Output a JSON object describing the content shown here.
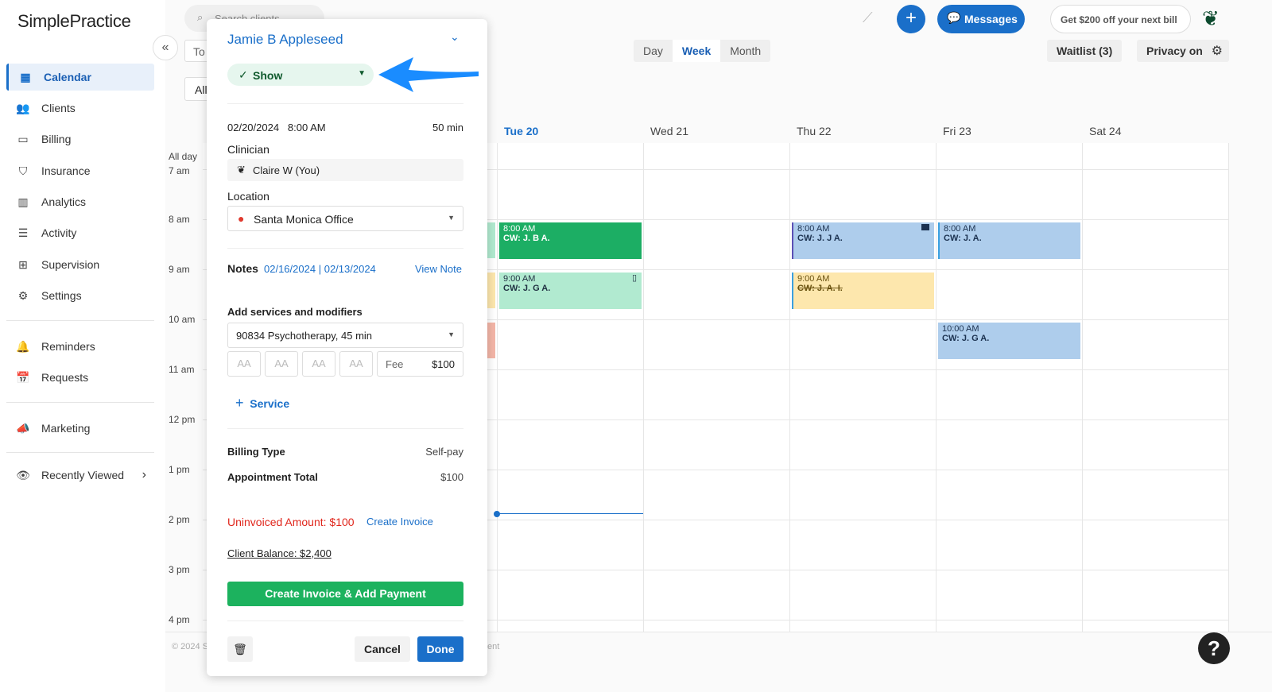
{
  "app": {
    "logo": "SimplePractice"
  },
  "sidebar": {
    "items": [
      {
        "label": "Calendar",
        "icon": "calendar-icon",
        "glyph": "▦"
      },
      {
        "label": "Clients",
        "icon": "users-icon",
        "glyph": "👥"
      },
      {
        "label": "Billing",
        "icon": "credit-card-icon",
        "glyph": "▭"
      },
      {
        "label": "Insurance",
        "icon": "shield-icon",
        "glyph": "⛉"
      },
      {
        "label": "Analytics",
        "icon": "bar-chart-icon",
        "glyph": "▥"
      },
      {
        "label": "Activity",
        "icon": "list-icon",
        "glyph": "☰"
      },
      {
        "label": "Supervision",
        "icon": "supervision-icon",
        "glyph": "⊞"
      },
      {
        "label": "Settings",
        "icon": "gear-icon",
        "glyph": "⚙"
      },
      {
        "label": "Reminders",
        "icon": "bell-icon",
        "glyph": "🔔"
      },
      {
        "label": "Requests",
        "icon": "calendar-plus-icon",
        "glyph": "📅"
      },
      {
        "label": "Marketing",
        "icon": "megaphone-icon",
        "glyph": "📣"
      },
      {
        "label": "Recently Viewed",
        "icon": "eye-icon",
        "glyph": "👁"
      }
    ]
  },
  "header": {
    "search_placeholder": "Search clients",
    "messages": "Messages",
    "promo": "Get $200 off your next bill",
    "today": "To",
    "filter": "All"
  },
  "calendar": {
    "views": [
      "Day",
      "Week",
      "Month"
    ],
    "active_view": "Week",
    "waitlist": "Waitlist (3)",
    "privacy": "Privacy on",
    "days": [
      "Tue 20",
      "Wed 21",
      "Thu 22",
      "Fri 23",
      "Sat 24"
    ],
    "all_day": "All day",
    "hours": [
      "7 am",
      "8 am",
      "9 am",
      "10 am",
      "11 am",
      "12 pm",
      "1 pm",
      "2 pm",
      "3 pm",
      "4 pm"
    ],
    "events": [
      {
        "time": "8:00 AM",
        "title": "CW: J. B A.",
        "color": "#1cae64"
      },
      {
        "time": "9:00 AM",
        "title": "CW: J. G A.",
        "color": "#b1ead0"
      },
      {
        "time": "8:00 AM",
        "title": "CW: J. J A.",
        "color": "#aecdec"
      },
      {
        "time": "9:00 AM",
        "title": "CW: J. A. I.",
        "color": "#fde7ad"
      },
      {
        "time": "8:00 AM",
        "title": "CW: J. A.",
        "color": "#aecdec"
      },
      {
        "time": "10:00 AM",
        "title": "CW: J. G A.",
        "color": "#aecdec"
      }
    ],
    "footer": "© 2024 S",
    "footer_right": "ent"
  },
  "popup": {
    "client": "Jamie B Appleseed",
    "status": "Show",
    "date": "02/20/2024",
    "time": "8:00 AM",
    "duration": "50 min",
    "clinician_label": "Clinician",
    "clinician": "Claire W (You)",
    "location_label": "Location",
    "location": "Santa Monica Office",
    "notes_label": "Notes",
    "note1": "02/16/2024",
    "note_sep": "|",
    "note2": "02/13/2024",
    "view_note": "View Note",
    "services_label": "Add services and modifiers",
    "service": "90834 Psychotherapy, 45 min",
    "modifier": "AA",
    "fee_label": "Fee",
    "fee": "$100",
    "add_service": "Service",
    "billing_type_label": "Billing Type",
    "billing_type": "Self-pay",
    "total_label": "Appointment Total",
    "total": "$100",
    "uninvoiced": "Uninvoiced Amount: $100",
    "create_invoice": "Create Invoice",
    "balance": "Client Balance: $2,400",
    "primary": "Create Invoice & Add Payment",
    "cancel": "Cancel",
    "done": "Done"
  }
}
